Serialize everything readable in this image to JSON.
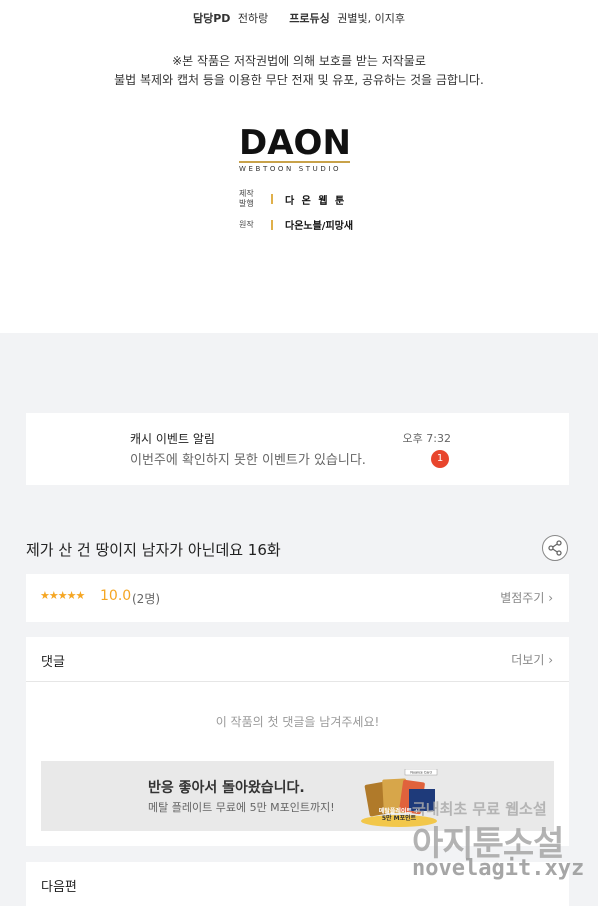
{
  "credits": {
    "pd_label": "담당PD",
    "pd_name": "전하랑",
    "producing_label": "프로듀싱",
    "producing_names": "권별빛, 이지후"
  },
  "notice": {
    "line1": "※본 작품은 저작권법에 의해 보호를 받는 저작물로",
    "line2": "불법 복제와 캡처 등을 이용한 무단 전재 및 유포, 공유하는 것을 금합니다."
  },
  "studio": {
    "logo": "DAON",
    "logo_sub": "WEBTOON STUDIO",
    "rows": [
      {
        "label_1": "제작",
        "label_2": "발행",
        "value": "다 온 웹 툰"
      },
      {
        "label_1": "원작",
        "label_2": "",
        "value": "다온노블/피망새"
      }
    ]
  },
  "alert": {
    "title": "캐시 이벤트 알림",
    "message": "이번주에 확인하지 못한 이벤트가 있습니다.",
    "time": "오후 7:32",
    "badge": "1"
  },
  "episode": {
    "title": "제가 산 건 땅이지 남자가 아닌데요 16화"
  },
  "rating": {
    "stars": "★★★★★",
    "score": "10.0",
    "count": "(2명)",
    "rate_button": "별점주기 ›"
  },
  "comments": {
    "header": "댓글",
    "more": "더보기 ›",
    "empty": "이 작품의 첫 댓글을 남겨주세요!"
  },
  "banner": {
    "title": "반응 좋아서 돌아왔습니다.",
    "subtitle": "메탈 플레이트 무료에 5만 M포인트까지!",
    "card_tag": "Nuance Card",
    "card_text_1": "메탈플레이트 +",
    "card_text_2": "5만 M포인트"
  },
  "next": {
    "header": "다음편"
  },
  "watermark": {
    "line1": "국내최초 무료 웹소설",
    "line2": "아지툰소설",
    "line3": "novelagit.xyz"
  },
  "colors": {
    "accent_orange": "#f5a623",
    "badge_red": "#e8452c",
    "logo_gold": "#c8a24a",
    "page_gray": "#f2f3f5"
  }
}
